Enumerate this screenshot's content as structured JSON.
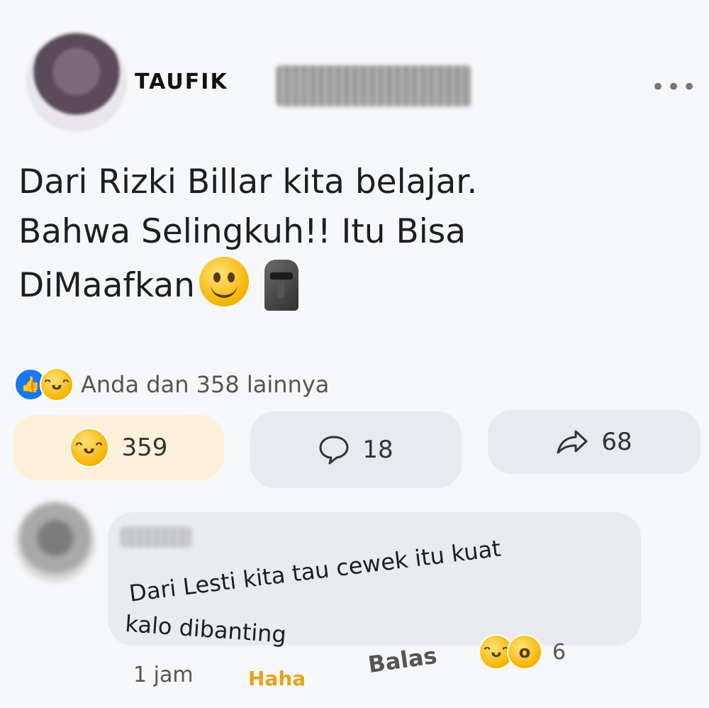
{
  "post": {
    "author": "TAUFIK",
    "text_line1": "Dari Rizki Billar kita belajar.",
    "text_line2": "Bahwa Selingkuh!! Itu Bisa",
    "text_line3": "DiMaafkan",
    "emoji1": "smiling-face",
    "emoji2": "moai"
  },
  "reactions": {
    "summary": "Anda dan 358 lainnya",
    "icons": [
      "like-icon",
      "haha-icon"
    ]
  },
  "actions": {
    "haha_count": "359",
    "comment_count": "18",
    "share_count": "68"
  },
  "comment": {
    "text_part1": "Dari Lesti kita tau cewek itu kuat",
    "text_part2": "kalo dibanting",
    "time": "1 jam",
    "haha_label": "Haha",
    "reply_label": "Balas",
    "reaction_count": "6"
  },
  "colors": {
    "accent_blue": "#1877f2",
    "haha_bg": "#fbf0da",
    "button_grey": "#e7eaee",
    "haha_text": "#e8a21b"
  }
}
